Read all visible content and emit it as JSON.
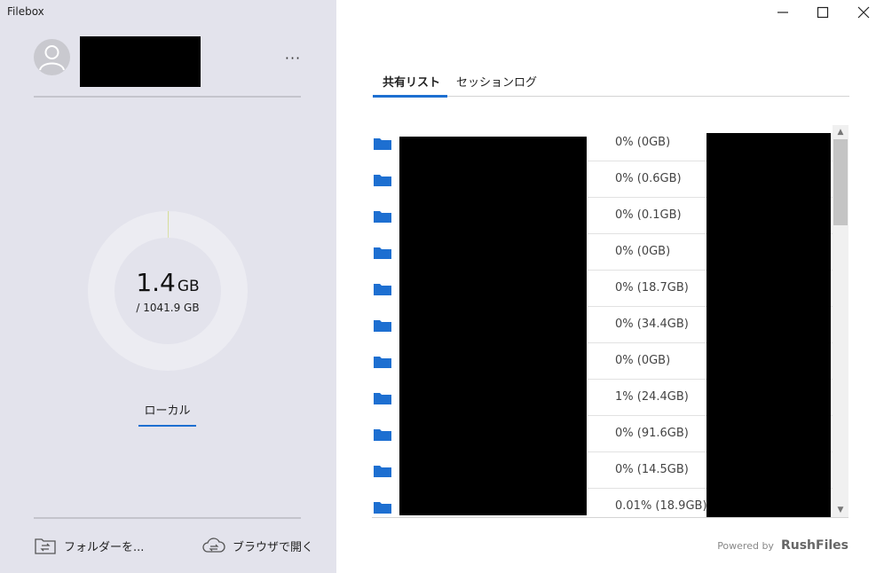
{
  "app": {
    "title": "Filebox"
  },
  "account": {
    "menu_label": "···"
  },
  "storage": {
    "used_value": "1.4",
    "used_unit": "GB",
    "total_label": "/  1041.9 GB",
    "used_fraction": 0.0013,
    "colors": {
      "ring": "#ececf2",
      "used": "#d6dd9a"
    }
  },
  "left_tabs": [
    {
      "label": "ローカル",
      "active": true
    }
  ],
  "bottom_actions": [
    {
      "label": "フォルダーを...",
      "icon": "folder-sync-icon"
    },
    {
      "label": "ブラウザで開く",
      "icon": "cloud-sync-icon"
    }
  ],
  "tabs": [
    {
      "label": "共有リスト",
      "active": true
    },
    {
      "label": "セッションログ",
      "active": false
    }
  ],
  "shares": [
    {
      "usage": "0% (0GB)"
    },
    {
      "usage": "0% (0.6GB)"
    },
    {
      "usage": "0% (0.1GB)"
    },
    {
      "usage": "0% (0GB)"
    },
    {
      "usage": "0% (18.7GB)"
    },
    {
      "usage": "0% (34.4GB)"
    },
    {
      "usage": "0% (0GB)"
    },
    {
      "usage": "1% (24.4GB)"
    },
    {
      "usage": "0% (91.6GB)"
    },
    {
      "usage": "0% (14.5GB)"
    },
    {
      "usage": "0.01% (18.9GB)"
    }
  ],
  "footer": {
    "powered_by": "Powered by",
    "brand": "RushFiles"
  },
  "colors": {
    "accent": "#1d6fd1",
    "folder": "#1d6fd1",
    "sidebar_bg": "#e3e3ec"
  }
}
